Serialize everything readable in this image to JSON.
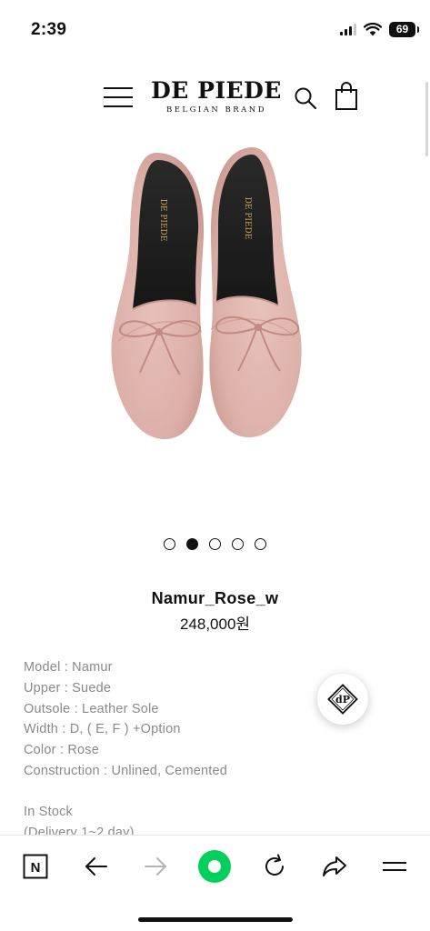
{
  "status_bar": {
    "time": "2:39",
    "battery": "69"
  },
  "header": {
    "logo_main": "DE PIEDE",
    "logo_sub": "BELGIAN BRAND"
  },
  "product_image": {
    "logo_text": "DE PIEDE",
    "color": "#e2b8b1"
  },
  "carousel": {
    "total": 5,
    "active_index": 1
  },
  "product": {
    "name": "Namur_Rose_w",
    "price": "248,000원",
    "specs": [
      "Model : Namur",
      "Upper : Suede",
      "Outsole : Leather Sole",
      "Width : D, ( E, F ) +Option",
      "Color : Rose",
      "Construction : Unlined, Cemented"
    ],
    "stock": "In Stock",
    "delivery": "(Delivery 1~2 day)"
  },
  "float_badge": {
    "text": "dP"
  },
  "browser_toolbar": {
    "n_label": "N",
    "accent_color": "#03cf5d"
  }
}
